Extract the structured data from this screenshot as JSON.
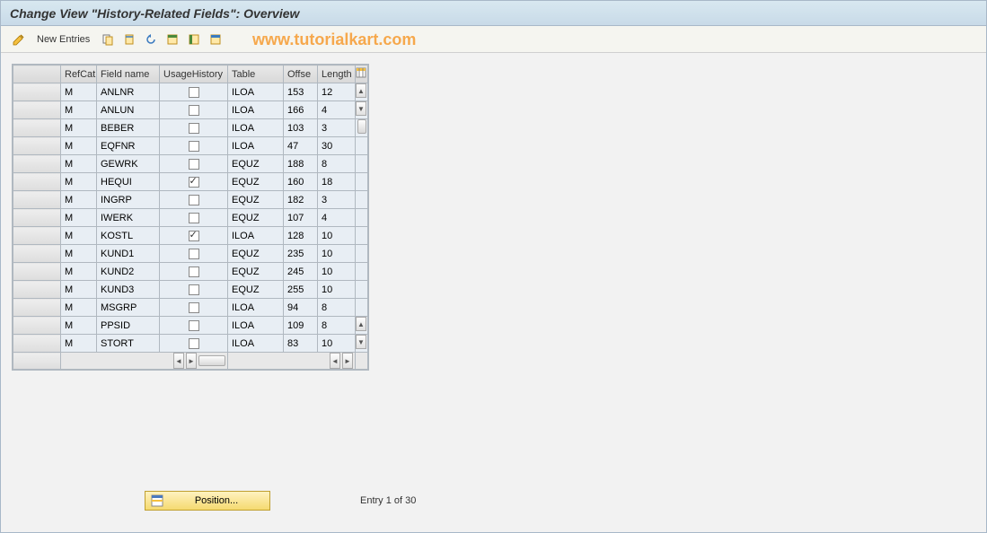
{
  "title": "Change View \"History-Related Fields\": Overview",
  "toolbar": {
    "new_entries_label": "New Entries"
  },
  "watermark": "www.tutorialkart.com",
  "grid": {
    "headers": {
      "refcat": "RefCat",
      "field_name": "Field name",
      "usage_history": "UsageHistory",
      "table": "Table",
      "offset": "Offse",
      "length": "Length"
    },
    "rows": [
      {
        "refcat": "M",
        "field": "ANLNR",
        "usage": false,
        "table": "ILOA",
        "offset": "153",
        "length": "12"
      },
      {
        "refcat": "M",
        "field": "ANLUN",
        "usage": false,
        "table": "ILOA",
        "offset": "166",
        "length": "4"
      },
      {
        "refcat": "M",
        "field": "BEBER",
        "usage": false,
        "table": "ILOA",
        "offset": "103",
        "length": "3"
      },
      {
        "refcat": "M",
        "field": "EQFNR",
        "usage": false,
        "table": "ILOA",
        "offset": "47",
        "length": "30"
      },
      {
        "refcat": "M",
        "field": "GEWRK",
        "usage": false,
        "table": "EQUZ",
        "offset": "188",
        "length": "8"
      },
      {
        "refcat": "M",
        "field": "HEQUI",
        "usage": true,
        "table": "EQUZ",
        "offset": "160",
        "length": "18"
      },
      {
        "refcat": "M",
        "field": "INGRP",
        "usage": false,
        "table": "EQUZ",
        "offset": "182",
        "length": "3"
      },
      {
        "refcat": "M",
        "field": "IWERK",
        "usage": false,
        "table": "EQUZ",
        "offset": "107",
        "length": "4"
      },
      {
        "refcat": "M",
        "field": "KOSTL",
        "usage": true,
        "table": "ILOA",
        "offset": "128",
        "length": "10"
      },
      {
        "refcat": "M",
        "field": "KUND1",
        "usage": false,
        "table": "EQUZ",
        "offset": "235",
        "length": "10"
      },
      {
        "refcat": "M",
        "field": "KUND2",
        "usage": false,
        "table": "EQUZ",
        "offset": "245",
        "length": "10"
      },
      {
        "refcat": "M",
        "field": "KUND3",
        "usage": false,
        "table": "EQUZ",
        "offset": "255",
        "length": "10"
      },
      {
        "refcat": "M",
        "field": "MSGRP",
        "usage": false,
        "table": "ILOA",
        "offset": "94",
        "length": "8"
      },
      {
        "refcat": "M",
        "field": "PPSID",
        "usage": false,
        "table": "ILOA",
        "offset": "109",
        "length": "8"
      },
      {
        "refcat": "M",
        "field": "STORT",
        "usage": false,
        "table": "ILOA",
        "offset": "83",
        "length": "10"
      }
    ]
  },
  "footer": {
    "position_label": "Position...",
    "entry_text": "Entry 1 of 30"
  }
}
